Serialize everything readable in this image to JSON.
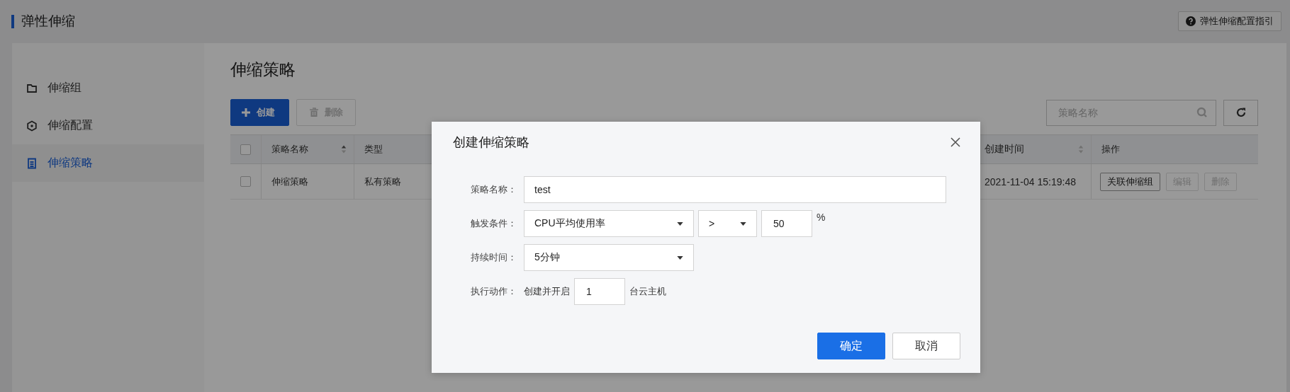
{
  "header": {
    "title": "弹性伸缩",
    "guide_button": "弹性伸缩配置指引"
  },
  "sidebar": {
    "items": [
      {
        "label": "伸缩组",
        "kind": "folder",
        "selected": false
      },
      {
        "label": "伸缩配置",
        "kind": "hexagon",
        "selected": false
      },
      {
        "label": "伸缩策略",
        "kind": "list",
        "selected": true
      }
    ]
  },
  "content": {
    "title": "伸缩策略",
    "toolbar": {
      "create_button": {
        "label": "创建",
        "disabled": false
      },
      "delete_button": {
        "label": "删除",
        "disabled": true
      },
      "search": {
        "placeholder": "策略名称"
      }
    },
    "table": {
      "header_checked": false,
      "columns": [
        {
          "label": "策略名称",
          "sortable": true
        },
        {
          "label": "类型",
          "sortable": false
        },
        {
          "label": "创建时间",
          "sortable": true
        },
        {
          "label": "操作",
          "sortable": false
        }
      ],
      "rows": [
        {
          "checked": false,
          "name": "伸缩策略",
          "type": "私有策略",
          "created": "2021-11-04 15:19:48",
          "actions": [
            {
              "label": "关联伸缩组",
              "disabled": false
            },
            {
              "label": "编辑",
              "disabled": true
            },
            {
              "label": "删除",
              "disabled": true
            }
          ]
        }
      ]
    }
  },
  "dialog": {
    "title": "创建伸缩策略",
    "name_field": {
      "label": "策略名称：",
      "value": "test"
    },
    "trigger": {
      "label": "触发条件：",
      "metric": "CPU平均使用率",
      "operator": ">",
      "threshold": "50",
      "unit": "%"
    },
    "duration": {
      "label": "持续时间：",
      "value": "5分钟"
    },
    "action": {
      "label": "执行动作：",
      "prefix": "创建并开启",
      "count": "1",
      "suffix": "台云主机"
    },
    "confirm_button": "确定",
    "cancel_button": "取消"
  }
}
